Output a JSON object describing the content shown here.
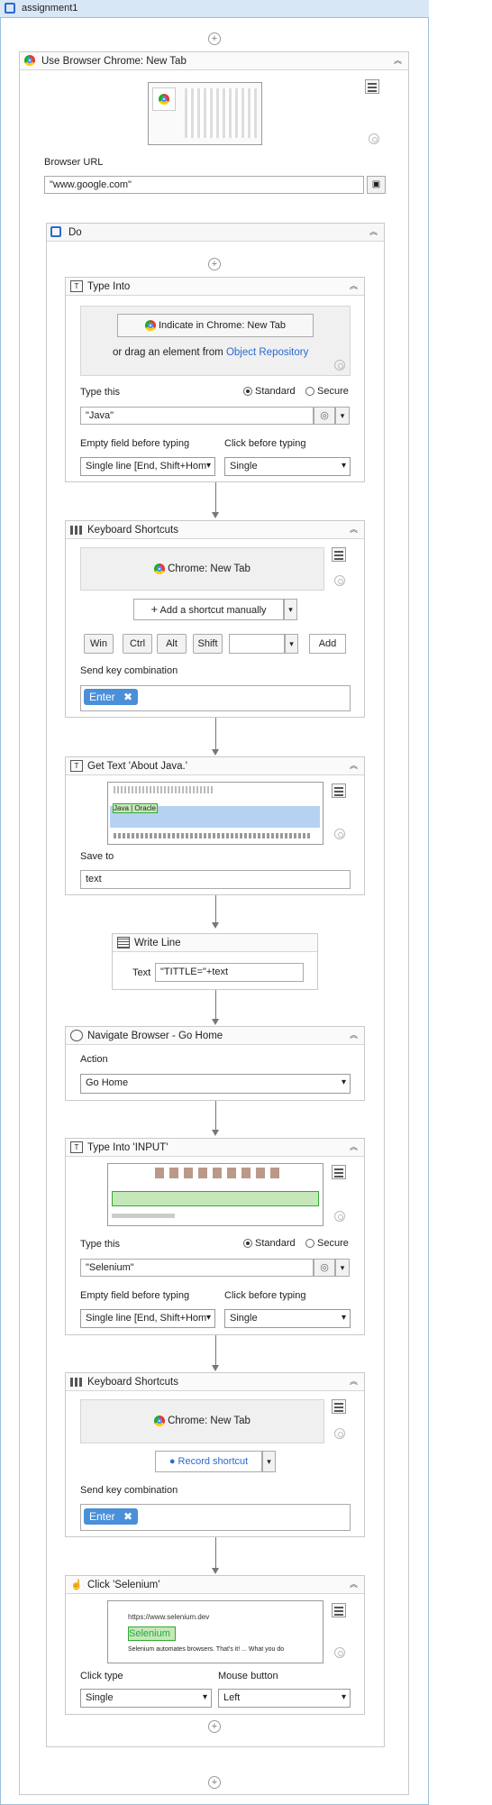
{
  "root": {
    "title": "assignment1"
  },
  "browser": {
    "title": "Use Browser Chrome: New Tab",
    "url_label": "Browser URL",
    "url_value": "\"www.google.com\""
  },
  "do": {
    "title": "Do"
  },
  "type1": {
    "title": "Type Into",
    "indicate": "Indicate in Chrome: New Tab",
    "drag_text": "or drag an element from",
    "drag_link": "Object Repository",
    "type_this": "Type this",
    "standard": "Standard",
    "secure": "Secure",
    "value": "\"Java\"",
    "empty_label": "Empty field before typing",
    "empty_value": "Single line [End, Shift+Hom",
    "click_label": "Click before typing",
    "click_value": "Single"
  },
  "ks1": {
    "title": "Keyboard Shortcuts",
    "target": "Chrome: New Tab",
    "add_manual": "Add a shortcut manually",
    "keys": [
      "Win",
      "Ctrl",
      "Alt",
      "Shift"
    ],
    "add": "Add",
    "send_label": "Send key combination",
    "chip": "Enter"
  },
  "gettext": {
    "title": "Get Text 'About Java.'",
    "save_label": "Save to",
    "save_value": "text"
  },
  "writeline": {
    "title": "Write Line",
    "text_label": "Text",
    "text_value": "\"TITTLE=\"+text"
  },
  "nav": {
    "title": "Navigate Browser - Go Home",
    "action_label": "Action",
    "action_value": "Go Home"
  },
  "type2": {
    "title": "Type Into 'INPUT'",
    "type_this": "Type this",
    "standard": "Standard",
    "secure": "Secure",
    "value": "\"Selenium\"",
    "empty_label": "Empty field before typing",
    "empty_value": "Single line [End, Shift+Hom",
    "click_label": "Click before typing",
    "click_value": "Single"
  },
  "ks2": {
    "title": "Keyboard Shortcuts",
    "target": "Chrome: New Tab",
    "record": "Record shortcut",
    "send_label": "Send key combination",
    "chip": "Enter"
  },
  "click": {
    "title": "Click 'Selenium'",
    "type_label": "Click type",
    "type_value": "Single",
    "mouse_label": "Mouse button",
    "mouse_value": "Left"
  },
  "thumbs": {
    "java_label": "Java | Oracle",
    "selenium_url": "https://www.selenium.dev",
    "selenium_label": "Selenium",
    "selenium_desc": "Selenium automates browsers. That's it! ... What you do"
  }
}
